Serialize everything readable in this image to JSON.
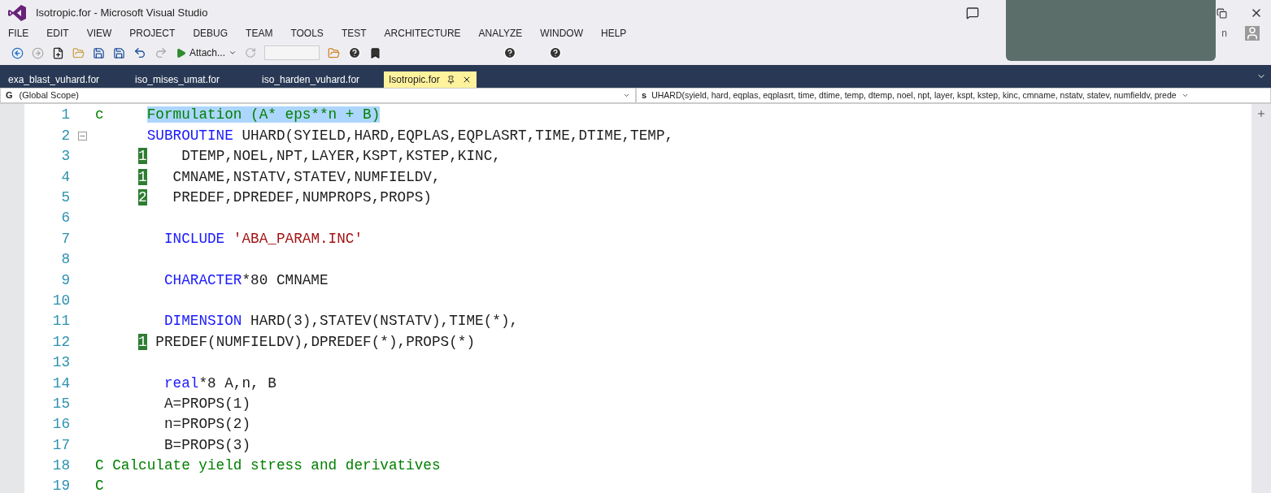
{
  "window": {
    "title": "Isotropic.for - Microsoft Visual Studio",
    "account": "n"
  },
  "menu": [
    "FILE",
    "EDIT",
    "VIEW",
    "PROJECT",
    "DEBUG",
    "TEAM",
    "TOOLS",
    "TEST",
    "ARCHITECTURE",
    "ANALYZE",
    "WINDOW",
    "HELP"
  ],
  "toolbar": {
    "attach": "Attach..."
  },
  "tabs": [
    {
      "label": "exa_blast_vuhard.for",
      "selected": false
    },
    {
      "label": "iso_mises_umat.for",
      "selected": false
    },
    {
      "label": "iso_harden_vuhard.for",
      "selected": false
    },
    {
      "label": "Isotropic.for",
      "selected": true
    }
  ],
  "scope_bar": {
    "left_icon": "G",
    "left": "(Global Scope)",
    "right_icon": "s",
    "right": "UHARD(syield, hard, eqplas, eqplasrt, time, dtime, temp, dtemp, noel, npt, layer, kspt, kstep, kinc, cmname, nstatv, statev, numfieldv, prede"
  },
  "editor": {
    "lines": [
      {
        "number": "1",
        "segments": [
          {
            "kind": "comment",
            "text": "c     "
          },
          {
            "kind": "selected_comment",
            "text": "Formulation (A* eps**n + B)"
          }
        ]
      },
      {
        "number": "2",
        "collapsible": true,
        "segments": [
          {
            "kind": "keyword",
            "text": "      SUBROUTINE"
          },
          {
            "kind": "plain",
            "text": " UHARD(SYIELD,HARD,EQPLAS,EQPLASRT,TIME,DTIME,TEMP,"
          }
        ]
      },
      {
        "number": "3",
        "segments": [
          {
            "kind": "marker",
            "text": "     1"
          },
          {
            "kind": "plain",
            "text": "    DTEMP,NOEL,NPT,LAYER,KSPT,KSTEP,KINC,"
          }
        ]
      },
      {
        "number": "4",
        "segments": [
          {
            "kind": "marker",
            "text": "     1"
          },
          {
            "kind": "plain",
            "text": "   CMNAME,NSTATV,STATEV,NUMFIELDV,"
          }
        ]
      },
      {
        "number": "5",
        "segments": [
          {
            "kind": "marker",
            "text": "     2"
          },
          {
            "kind": "plain",
            "text": "   PREDEF,DPREDEF,NUMPROPS,PROPS)"
          }
        ]
      },
      {
        "number": "6"
      },
      {
        "number": "7",
        "segments": [
          {
            "kind": "keyword",
            "text": "        INCLUDE"
          },
          {
            "kind": "string",
            "text": " 'ABA_PARAM.INC'"
          }
        ]
      },
      {
        "number": "8"
      },
      {
        "number": "9",
        "segments": [
          {
            "kind": "keyword",
            "text": "        CHARACTER"
          },
          {
            "kind": "plain",
            "text": "*80 CMNAME"
          }
        ]
      },
      {
        "number": "10"
      },
      {
        "number": "11",
        "segments": [
          {
            "kind": "keyword",
            "text": "        DIMENSION"
          },
          {
            "kind": "plain",
            "text": " HARD(3),STATEV(NSTATV),TIME(*),"
          }
        ]
      },
      {
        "number": "12",
        "segments": [
          {
            "kind": "marker",
            "text": "     1"
          },
          {
            "kind": "plain",
            "text": " PREDEF(NUMFIELDV),DPREDEF(*),PROPS(*)"
          }
        ]
      },
      {
        "number": "13"
      },
      {
        "number": "14",
        "segments": [
          {
            "kind": "keyword",
            "text": "        real"
          },
          {
            "kind": "plain",
            "text": "*8 A,n, B"
          }
        ]
      },
      {
        "number": "15",
        "segments": [
          {
            "kind": "plain",
            "text": "        A=PROPS(1)"
          }
        ]
      },
      {
        "number": "16",
        "segments": [
          {
            "kind": "plain",
            "text": "        n=PROPS(2)"
          }
        ]
      },
      {
        "number": "17",
        "segments": [
          {
            "kind": "plain",
            "text": "        B=PROPS(3)"
          }
        ]
      },
      {
        "number": "18",
        "segments": [
          {
            "kind": "comment",
            "text": "C Calculate yield stress and derivatives"
          }
        ]
      },
      {
        "number": "19",
        "segments": [
          {
            "kind": "comment",
            "text": "C"
          }
        ]
      }
    ]
  }
}
